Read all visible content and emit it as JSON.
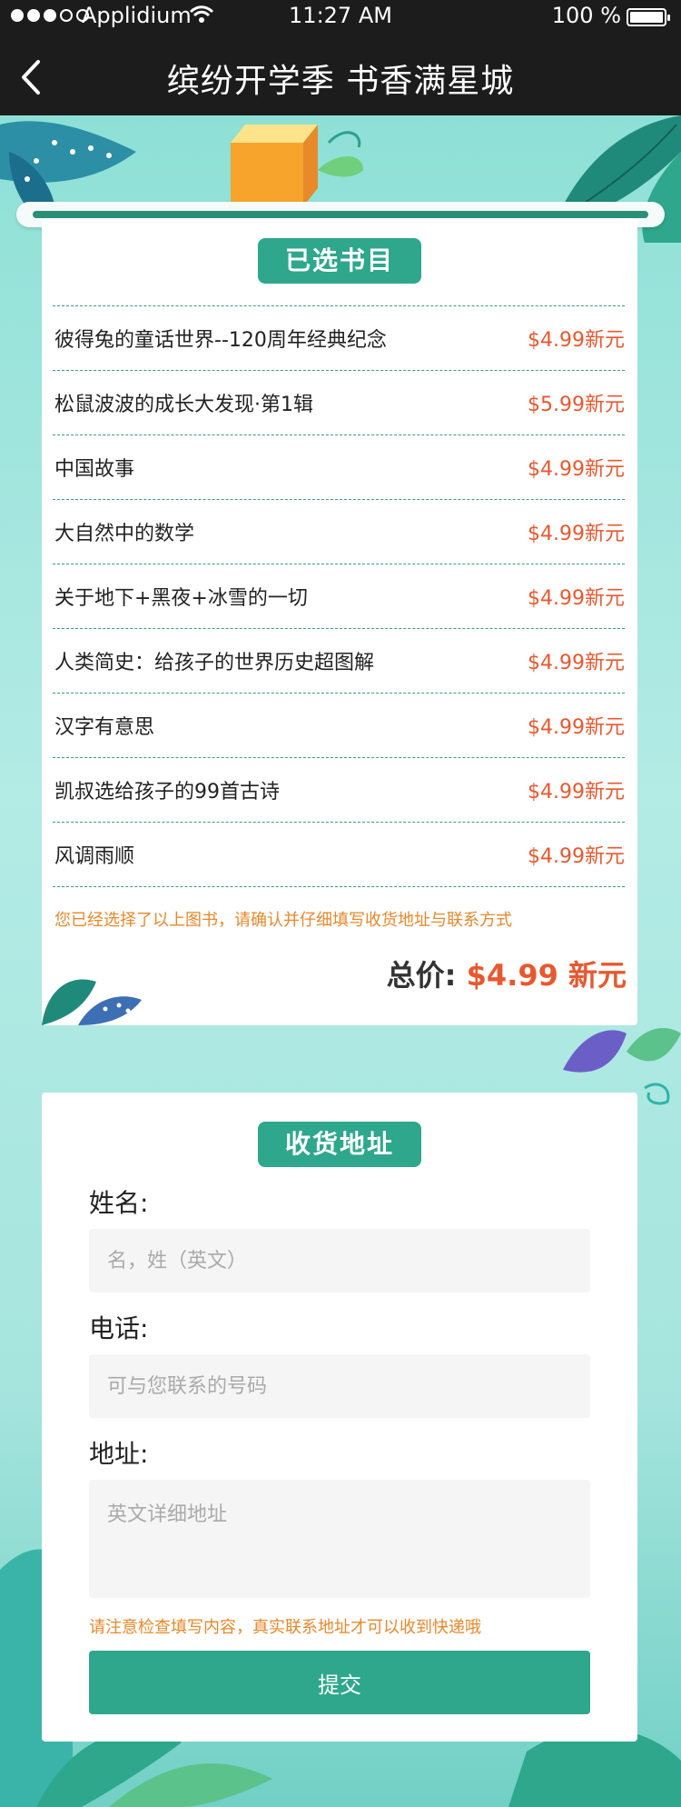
{
  "status_bar": {
    "carrier": "Applidium",
    "time": "11:27 AM",
    "battery": "100 %"
  },
  "nav": {
    "title": "缤纷开学季 书香满星城"
  },
  "books_card": {
    "title": "已选书目",
    "items": [
      {
        "name": "彼得兔的童话世界--120周年经典纪念",
        "price": "$4.99新元"
      },
      {
        "name": "松鼠波波的成长大发现·第1辑",
        "price": "$5.99新元"
      },
      {
        "name": "中国故事",
        "price": "$4.99新元"
      },
      {
        "name": "大自然中的数学",
        "price": "$4.99新元"
      },
      {
        "name": "关于地下+黑夜+冰雪的一切",
        "price": "$4.99新元"
      },
      {
        "name": "人类简史：给孩子的世界历史超图解",
        "price": "$4.99新元"
      },
      {
        "name": "汉字有意思",
        "price": "$4.99新元"
      },
      {
        "name": "凯叔选给孩子的99首古诗",
        "price": "$4.99新元"
      },
      {
        "name": "风调雨顺",
        "price": "$4.99新元"
      }
    ],
    "note": "您已经选择了以上图书，请确认并仔细填写收货地址与联系方式",
    "total_label": "总价:",
    "total_value": "$4.99 新元"
  },
  "address_card": {
    "title": "收货地址",
    "name_label": "姓名:",
    "name_placeholder": "名，姓（英文）",
    "phone_label": "电话:",
    "phone_placeholder": "可与您联系的号码",
    "address_label": "地址:",
    "address_placeholder": "英文详细地址",
    "note": "请注意检查填写内容，真实联系地址才可以收到快递哦",
    "submit_label": "提交"
  },
  "colors": {
    "accent": "#2ea78d",
    "price": "#e8582f",
    "note": "#e8882a",
    "navbar": "#1c1c1c"
  }
}
